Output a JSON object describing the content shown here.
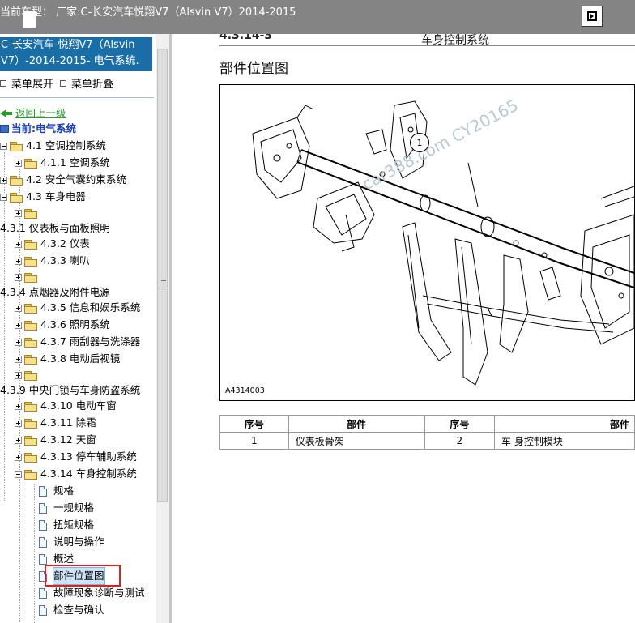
{
  "window": {
    "title": "当前车型：  厂家:C-长安汽车悦翔V7（Alsvin V7）2014-2015"
  },
  "sidebar": {
    "header": "C-长安汽车-悦翔V7（Alsvin V7）-2014-2015- 电气系统.",
    "expand_all": "菜单展开",
    "collapse_all": "菜单折叠",
    "back": "返回上一级",
    "current": "当前:电气系统",
    "tree": [
      "4.1 空调控制系统",
      "4.1.1 空调系统",
      "4.2 安全气囊约束系统",
      "4.3 车身电器",
      "",
      "4.3.1 仪表板与面板照明",
      "4.3.2 仪表",
      "4.3.3 喇叭",
      "",
      "4.3.4 点烟器及附件电源",
      "4.3.5 信息和娱乐系统",
      "4.3.6 照明系统",
      "4.3.7 雨刮器与洗涤器",
      "4.3.8 电动后视镜",
      "",
      "4.3.9 中央门锁与车身防盗系统",
      "4.3.10 电动车窗",
      "4.3.11 除霜",
      "4.3.12 天窗",
      "4.3.13 停车辅助系统",
      "4.3.14 车身控制系统",
      "规格",
      "一规规格",
      "扭矩规格",
      "说明与操作",
      "概述",
      "部件位置图",
      "故障现象诊断与测试",
      "检查与确认"
    ]
  },
  "content": {
    "section_number": "4.3.14-3",
    "section_title": "车身控制系统",
    "page_heading": "部件位置图",
    "figure_code": "A4314003",
    "callout": "1",
    "watermark": "car388.com CY20165",
    "table": {
      "headers": [
        "序号",
        "部件",
        "序号",
        "部件"
      ],
      "rows": [
        [
          "1",
          "仪表板骨架",
          "2",
          "车 身控制模块"
        ]
      ]
    }
  },
  "colors": {
    "titlebar": "#848484",
    "sidebar_header": "#1a6ea8",
    "back_link": "#2b9a2b",
    "current_link": "#1a3fbf",
    "highlight_box": "#e02020"
  }
}
